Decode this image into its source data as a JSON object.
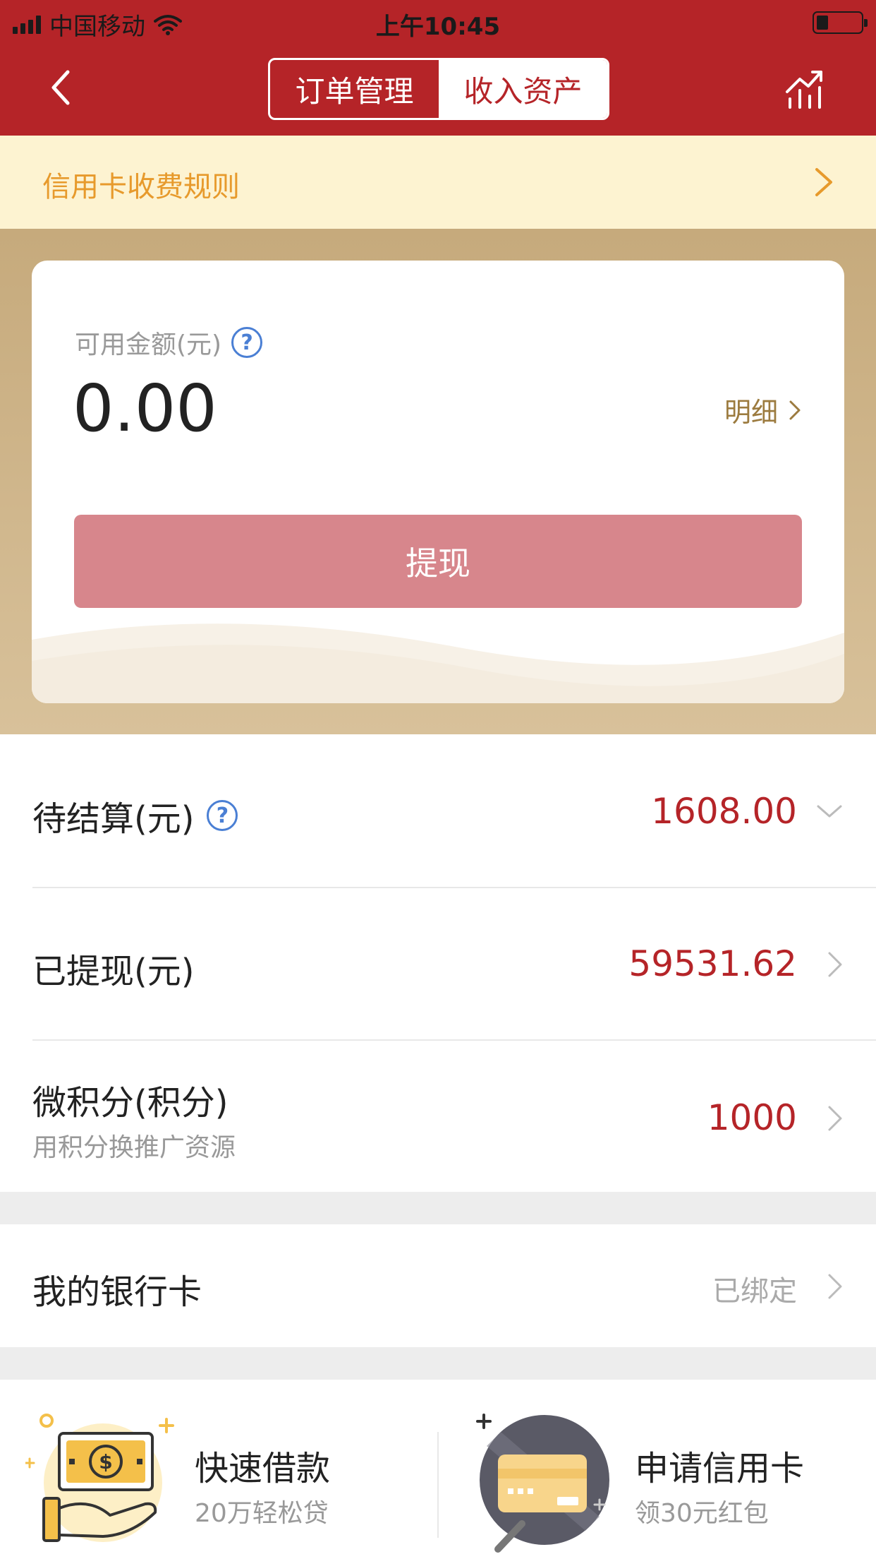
{
  "status_bar": {
    "carrier": "中国移动",
    "time": "上午10:45"
  },
  "header": {
    "tabs": [
      {
        "label": "订单管理",
        "active": false
      },
      {
        "label": "收入资产",
        "active": true
      }
    ]
  },
  "notice": {
    "text": "信用卡收费规则"
  },
  "balance_card": {
    "label": "可用金额(元)",
    "amount": "0.00",
    "detail_label": "明细",
    "withdraw_label": "提现"
  },
  "rows": {
    "pending": {
      "label": "待结算(元)",
      "value": "1608.00"
    },
    "withdrawn": {
      "label": "已提现(元)",
      "value": "59531.62"
    },
    "points": {
      "label": "微积分(积分)",
      "sub": "用积分换推广资源",
      "value": "1000"
    },
    "bank_card": {
      "label": "我的银行卡",
      "status": "已绑定"
    }
  },
  "promos": [
    {
      "title": "快速借款",
      "sub": "20万轻松贷",
      "icon": "cash-hand-icon"
    },
    {
      "title": "申请信用卡",
      "sub": "领30元红包",
      "icon": "credit-card-icon"
    }
  ],
  "colors": {
    "brand_red": "#b52428",
    "gold": "#c6aa7c",
    "notice_orange": "#e79a2c"
  }
}
